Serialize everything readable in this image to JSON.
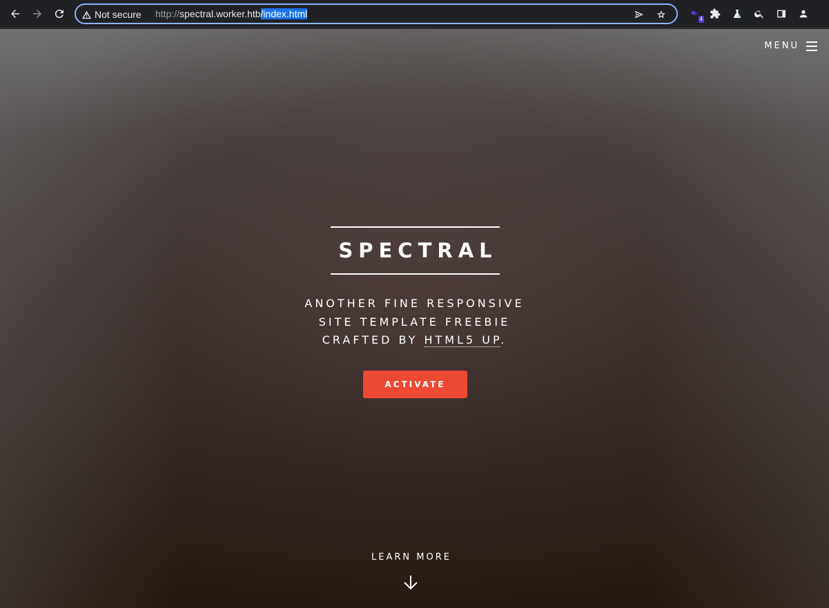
{
  "browser": {
    "security_label": "Not secure",
    "url_scheme": "http://",
    "url_host": "spectral.worker.htb",
    "url_path_selected": "/index.html",
    "extension_badge": "4",
    "icons": {
      "back": "arrow-left-icon",
      "forward": "arrow-right-icon",
      "reload": "reload-icon",
      "warning": "warning-triangle-icon",
      "send": "send-icon",
      "bookmark": "star-icon",
      "extension_1": "extension-badge-icon",
      "extensions": "puzzle-icon",
      "labs": "flask-icon",
      "search": "search-icon",
      "side_panel": "side-panel-icon",
      "profile": "profile-icon"
    },
    "colors": {
      "focus_ring": "#8ab4f8",
      "selection": "#1a73e8"
    }
  },
  "page": {
    "menu_label": "MENU",
    "title": "SPECTRAL",
    "tagline_lines": [
      "ANOTHER FINE RESPONSIVE",
      "SITE TEMPLATE FREEBIE",
      "CRAFTED BY "
    ],
    "tagline_link": "HTML5 UP",
    "tagline_end": ".",
    "cta_label": "ACTIVATE",
    "learn_more_label": "LEARN MORE",
    "colors": {
      "accent": "#ed4933",
      "text": "#ffffff"
    }
  }
}
